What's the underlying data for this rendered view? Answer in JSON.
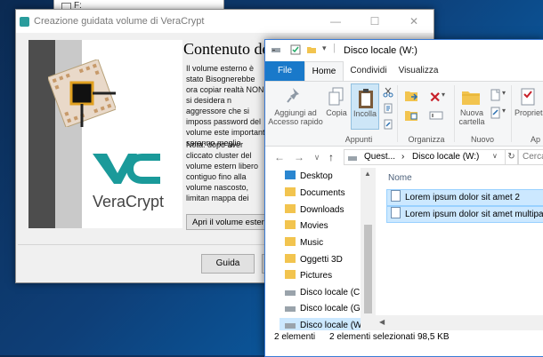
{
  "background_window": {
    "text": "F:"
  },
  "veracrypt": {
    "title": "Creazione guidata volume di VeraCrypt",
    "minimize": "—",
    "maximize": "☐",
    "close": "✕",
    "logo_text": "VeraCrypt",
    "heading": "Contenuto del",
    "paragraph1": "Il volume esterno è stato Bisognerebbe ora copiar realtà NON si desidera n aggressore che si imposs password del volume este importanti saranno meglio seguito. Terminata la cop",
    "paragraph2": "Nota: dopo aver cliccato cluster del volume estern libero contiguo fino alla volume nascosto, limitan mappa dei cluster del vo soprascritti dal volume n",
    "open_button": "Apri il volume esterno",
    "help_button": "Guida"
  },
  "explorer": {
    "title": "Disco locale (W:)",
    "tabs": {
      "file": "File",
      "home": "Home",
      "share": "Condividi",
      "view": "Visualizza"
    },
    "ribbon": {
      "pin_label": "Aggiungi ad Accesso rapido",
      "copy_label": "Copia",
      "paste_label": "Incolla",
      "clipboard_group": "Appunti",
      "organize_group": "Organizza",
      "new_folder_label": "Nuova cartella",
      "new_group": "Nuovo",
      "properties_label": "Proprietà",
      "open_group": "Ap"
    },
    "address": {
      "part1": "Quest...",
      "sep": "›",
      "part2": "Disco locale (W:)"
    },
    "search_placeholder": "Cerca",
    "nav_items": [
      {
        "label": "Desktop"
      },
      {
        "label": "Documents"
      },
      {
        "label": "Downloads"
      },
      {
        "label": "Movies"
      },
      {
        "label": "Music"
      },
      {
        "label": "Oggetti 3D"
      },
      {
        "label": "Pictures"
      },
      {
        "label": "Disco locale (C:)"
      },
      {
        "label": "Disco locale (G:)"
      },
      {
        "label": "Disco locale (W:)"
      }
    ],
    "column_name": "Nome",
    "files": [
      {
        "name": "Lorem ipsum dolor sit amet 2"
      },
      {
        "name": "Lorem ipsum dolor sit amet multipagin"
      }
    ],
    "status": {
      "count": "2 elementi",
      "selected": "2 elementi selezionati  98,5 KB"
    }
  },
  "colors": {
    "accent": "#1979ca",
    "veracrypt_teal": "#1a9a9a",
    "selection": "#cce8ff"
  }
}
